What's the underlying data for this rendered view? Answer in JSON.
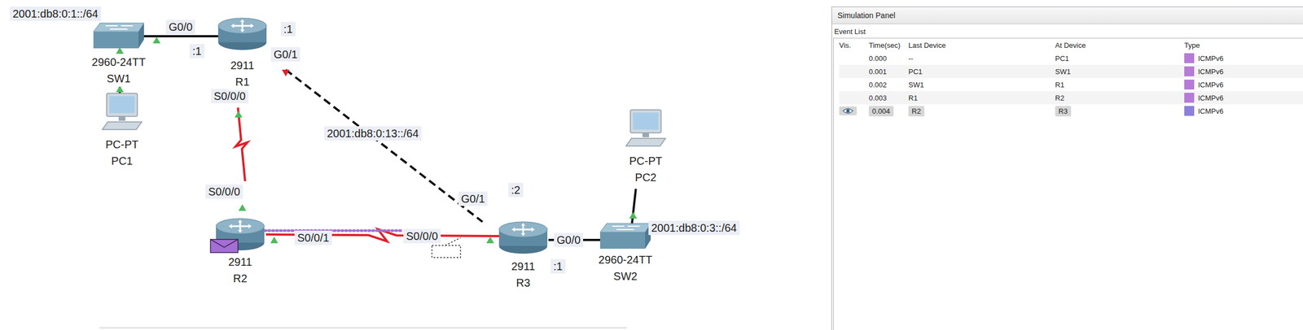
{
  "topology": {
    "devices": [
      {
        "name": "SW1",
        "model": "2960-24TT",
        "kind": "switch"
      },
      {
        "name": "R1",
        "model": "2911",
        "kind": "router"
      },
      {
        "name": "PC1",
        "model": "PC-PT",
        "kind": "pc"
      },
      {
        "name": "R2",
        "model": "2911",
        "kind": "router"
      },
      {
        "name": "R3",
        "model": "2911",
        "kind": "router"
      },
      {
        "name": "SW2",
        "model": "2960-24TT",
        "kind": "switch"
      },
      {
        "name": "PC2",
        "model": "PC-PT",
        "kind": "pc"
      }
    ],
    "labels": [
      {
        "text": "2001:db8:0:1::/64",
        "kind": "network"
      },
      {
        "text": "G0/0",
        "kind": "interface"
      },
      {
        "text": ":1",
        "kind": "address"
      },
      {
        "text": ":1",
        "kind": "address"
      },
      {
        "text": "G0/1",
        "kind": "interface"
      },
      {
        "text": "S0/0/0",
        "kind": "interface"
      },
      {
        "text": "2001:db8:0:13::/64",
        "kind": "network"
      },
      {
        "text": "S0/0/0",
        "kind": "interface"
      },
      {
        "text": "S0/0/1",
        "kind": "interface"
      },
      {
        "text": "S0/0/0",
        "kind": "interface"
      },
      {
        "text": "G0/1",
        "kind": "interface"
      },
      {
        "text": ":2",
        "kind": "address"
      },
      {
        "text": "G0/0",
        "kind": "interface"
      },
      {
        "text": ":1",
        "kind": "address"
      },
      {
        "text": "2001:db8:0:3::/64",
        "kind": "network"
      }
    ],
    "links": [
      {
        "from": "SW1",
        "to": "PC1",
        "kind": "ethernet",
        "from_state": "up",
        "to_state": "up",
        "packet_in_transit": false
      },
      {
        "from": "SW1",
        "to": "R1",
        "kind": "ethernet",
        "from_state": "up",
        "to_state": "none",
        "packet_in_transit": false
      },
      {
        "from": "R1",
        "to": "R2",
        "kind": "serial",
        "from_state": "up",
        "to_state": "up",
        "packet_in_transit": false
      },
      {
        "from": "R1",
        "to": "R3",
        "kind": "crossover",
        "from_state": "down",
        "to_state": "none",
        "packet_in_transit": false
      },
      {
        "from": "R2",
        "to": "R3",
        "kind": "serial",
        "from_state": "up",
        "to_state": "up",
        "packet_in_transit": true
      },
      {
        "from": "R3",
        "to": "SW2",
        "kind": "ethernet",
        "from_state": "none",
        "to_state": "none",
        "packet_in_transit": false
      },
      {
        "from": "SW2",
        "to": "PC2",
        "kind": "ethernet",
        "from_state": "up",
        "to_state": "none",
        "packet_in_transit": false
      }
    ],
    "packet": {
      "device": "R2",
      "color": "#a46fd4"
    }
  },
  "simulation_panel": {
    "title": "Simulation Panel",
    "event_list": {
      "label": "Event List",
      "columns": [
        "Vis.",
        "Time(sec)",
        "Last Device",
        "At Device",
        "Type"
      ],
      "rows": [
        {
          "visible": false,
          "time": "0.000",
          "last_device": "--",
          "at_device": "PC1",
          "type": "ICMPv6",
          "color": "#b57bd6",
          "selected": false
        },
        {
          "visible": false,
          "time": "0.001",
          "last_device": "PC1",
          "at_device": "SW1",
          "type": "ICMPv6",
          "color": "#b57bd6",
          "selected": false
        },
        {
          "visible": false,
          "time": "0.002",
          "last_device": "SW1",
          "at_device": "R1",
          "type": "ICMPv6",
          "color": "#b57bd6",
          "selected": false
        },
        {
          "visible": false,
          "time": "0.003",
          "last_device": "R1",
          "at_device": "R2",
          "type": "ICMPv6",
          "color": "#b57bd6",
          "selected": false
        },
        {
          "visible": true,
          "time": "0.004",
          "last_device": "R2",
          "at_device": "R3",
          "type": "ICMPv6",
          "color": "#8c7fdc",
          "selected": true
        }
      ]
    }
  }
}
